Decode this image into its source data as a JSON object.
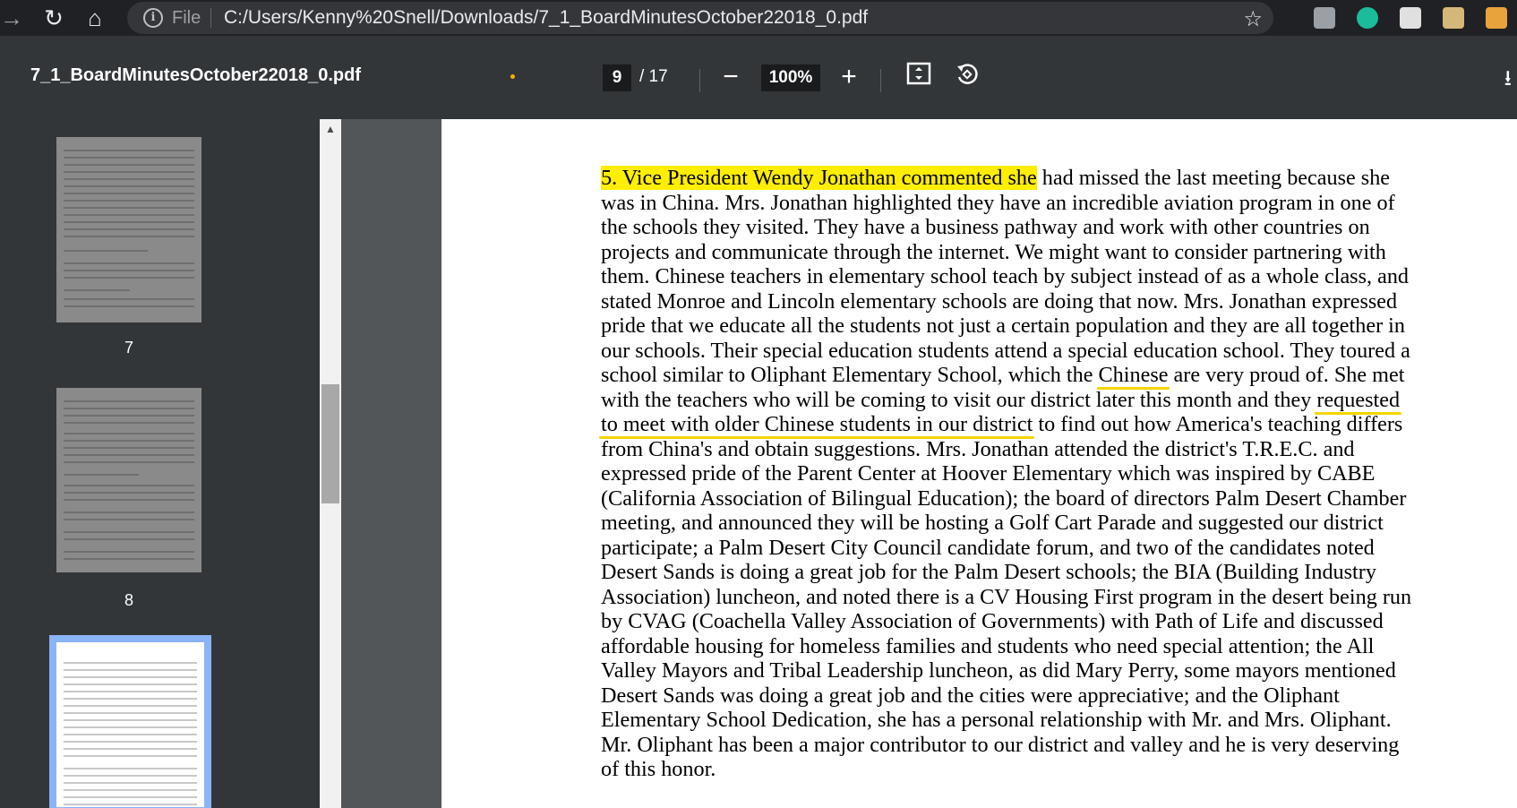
{
  "browser": {
    "omnibox_label": "File",
    "url": "C:/Users/Kenny%20Snell/Downloads/7_1_BoardMinutesOctober22018_0.pdf"
  },
  "toolbar": {
    "title": "7_1_BoardMinutesOctober22018_0.pdf",
    "current_page": "9",
    "total_pages": "/ 17",
    "zoom": "100%"
  },
  "sidebar": {
    "thumbnails": [
      {
        "label": "7"
      },
      {
        "label": "8"
      },
      {
        "label": ""
      }
    ]
  },
  "document": {
    "paragraph": {
      "highlighted_lead": "5. Vice President Wendy Jonathan commented she",
      "lines": [
        " had missed the last meeting because she",
        "was in China. Mrs. Jonathan highlighted they have an incredible aviation program in one of",
        "the schools they visited. They have a business pathway and work with other countries on",
        "projects and communicate through the internet. We might want to consider partnering with",
        "them. Chinese teachers in elementary school teach by subject instead of as a whole class, and",
        "stated Monroe and Lincoln elementary schools are doing that now. Mrs. Jonathan expressed",
        "pride that we educate all the students not just a certain population and they are all together in",
        "our schools. Their special education students attend a special education school. They toured a",
        "school similar to Oliphant Elementary School, which the ",
        "Chinese",
        " are very proud of. She met",
        "with the teachers who will be coming to visit our district later this month and they ",
        "requested",
        "to meet with older Chinese students in our district",
        " to find out how America's teaching differs",
        "from China's and obtain suggestions. Mrs. Jonathan attended the district's T.R.E.C. and",
        "expressed pride of the Parent Center at Hoover Elementary which was inspired by CABE",
        "(California Association of Bilingual Education); the board of directors Palm Desert Chamber",
        "meeting, and announced they will be hosting a Golf Cart Parade and suggested our district",
        "participate; a Palm Desert City Council candidate forum, and two of the candidates noted",
        "Desert Sands is doing a great job for the Palm Desert schools; the BIA (Building Industry",
        "Association) luncheon, and noted there is a CV Housing First program in the desert being run",
        "by CVAG (Coachella Valley Association of Governments) with Path of Life and discussed",
        "affordable housing for homeless families and students who need special attention; the All",
        "Valley Mayors and Tribal Leadership luncheon, as did Mary Perry, some mayors mentioned",
        "Desert Sands was doing a great job and the cities were appreciative; and the Oliphant",
        "Elementary School Dedication, she has a personal relationship with Mr. and Mrs. Oliphant.",
        "Mr. Oliphant has been a major contributor to our district and valley and he is very deserving",
        "of this honor."
      ]
    }
  },
  "colors": {
    "highlight": "#ffee00",
    "underline": "#f5d400",
    "toolbar_bg": "#323639",
    "browser_bg": "#202124",
    "viewer_bg": "#525659",
    "active_thumb_border": "#8ab4f8"
  },
  "icons": {
    "forward": "forward-arrow-icon",
    "reload": "reload-icon",
    "home": "home-icon",
    "info": "info-icon",
    "star": "bookmark-star-icon",
    "zoom_out": "minus-icon",
    "zoom_in": "plus-icon",
    "fit": "fit-to-page-icon",
    "rotate": "rotate-icon",
    "download": "download-icon"
  }
}
